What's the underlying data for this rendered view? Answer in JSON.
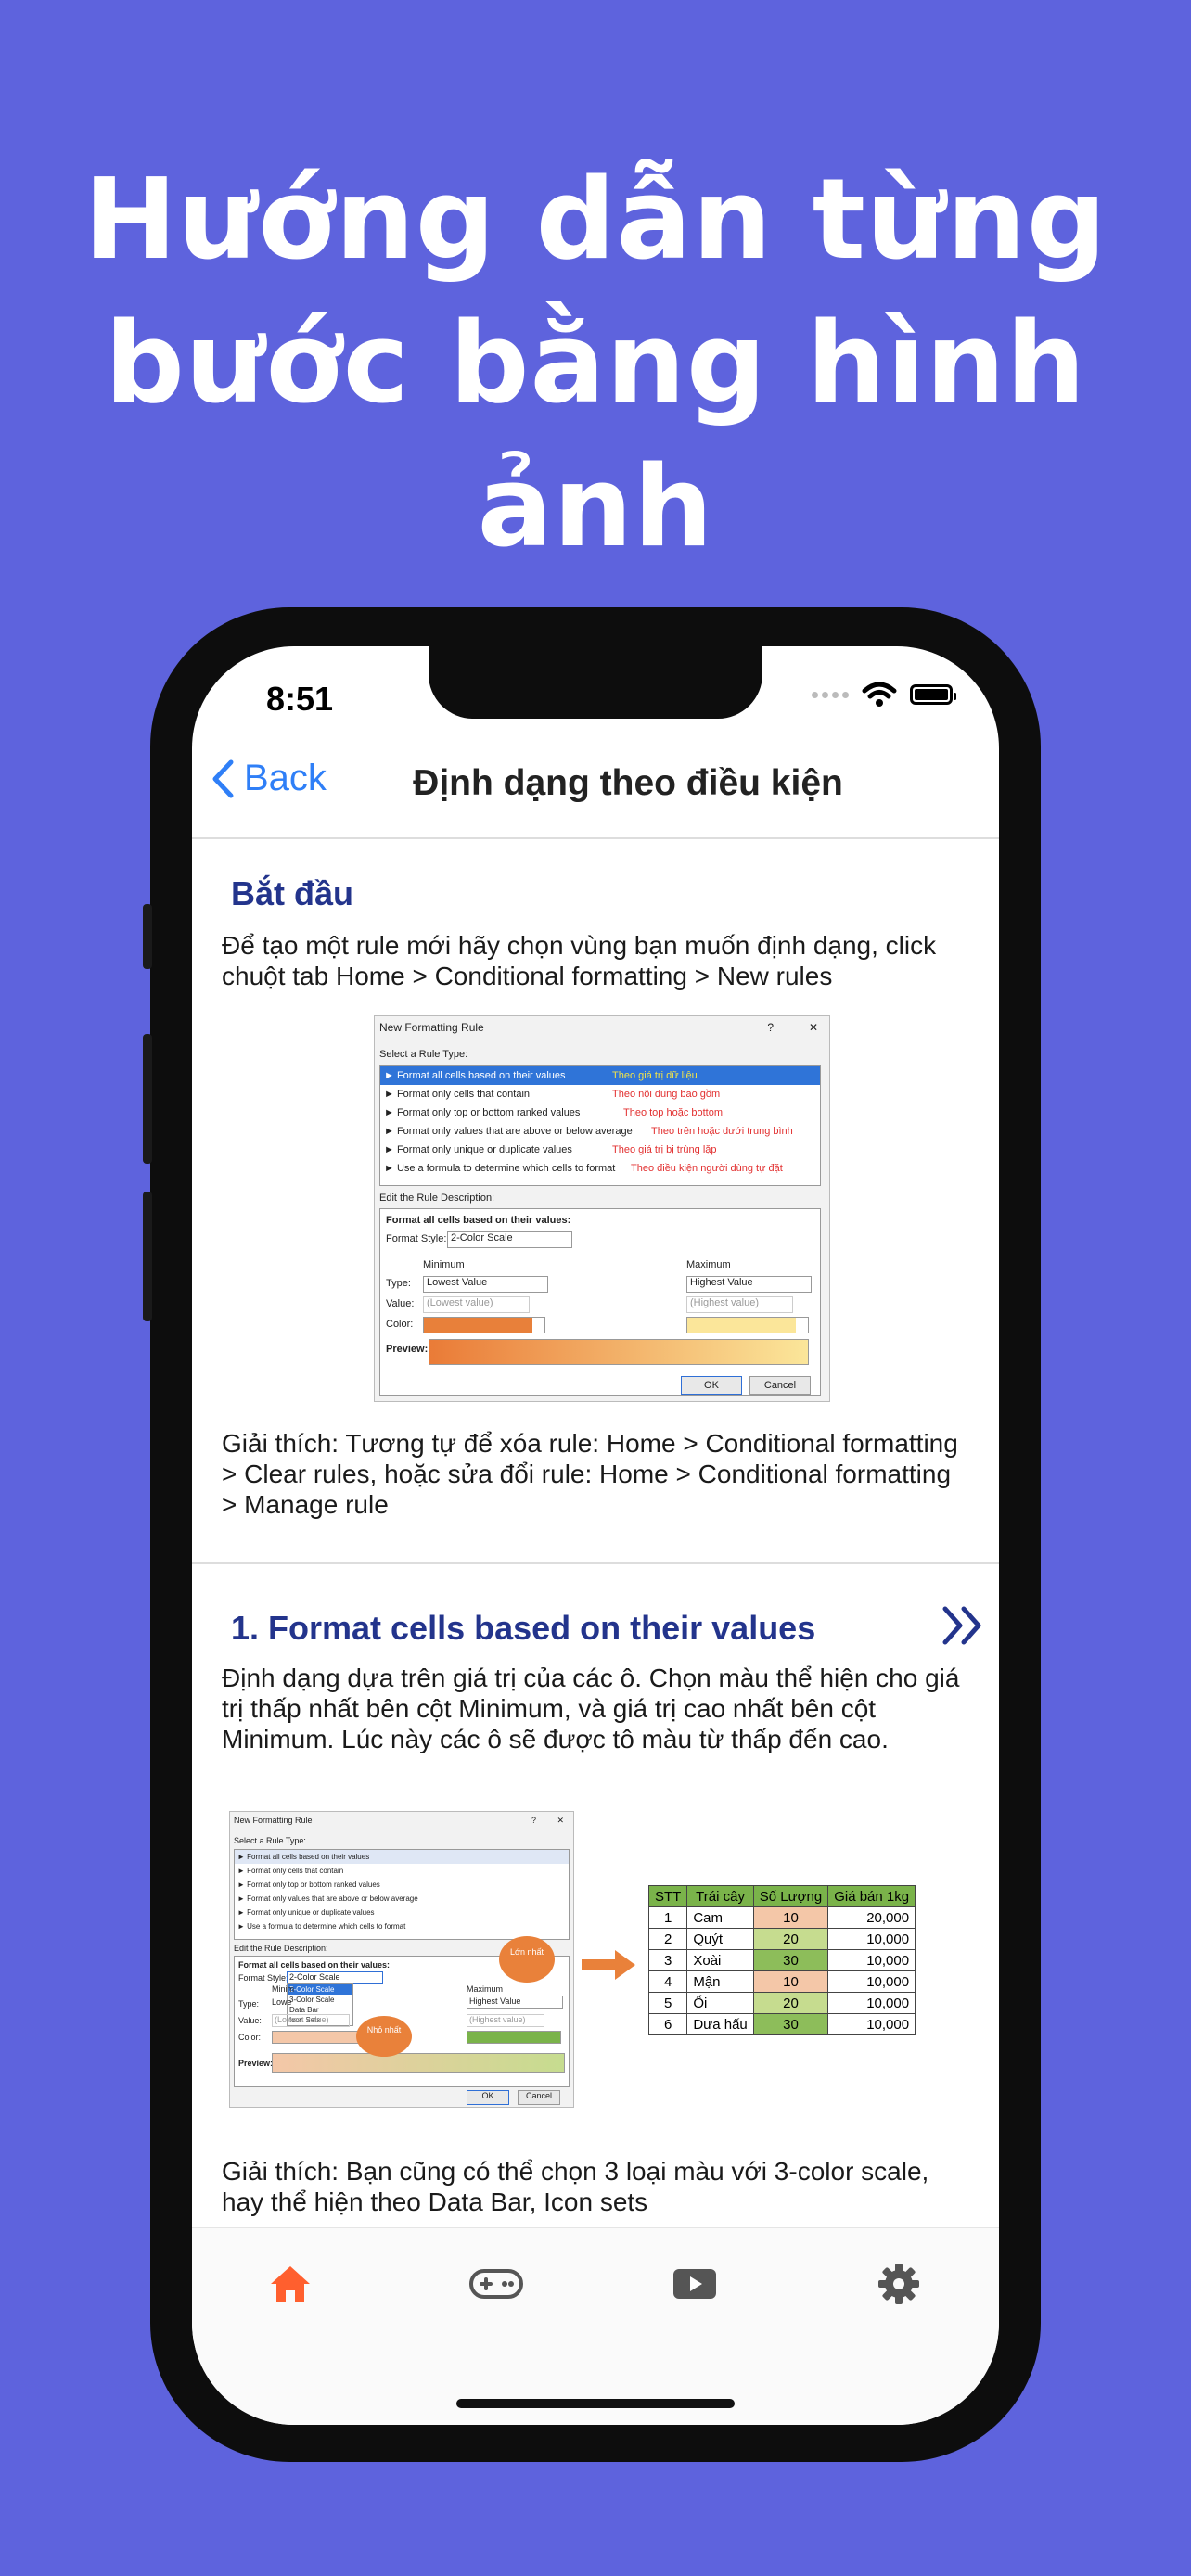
{
  "hero": {
    "line1": "Hướng dẫn từng",
    "line2": "bước bằng hình ảnh"
  },
  "status": {
    "time": "8:51"
  },
  "nav": {
    "back_label": "Back",
    "title": "Định dạng theo điều kiện"
  },
  "section_start": {
    "heading": "Bắt đầu",
    "intro": "Để tạo một rule mới hãy chọn vùng bạn muốn định dạng, click chuột tab Home > Conditional formatting > New rules",
    "explain": "Giải thích: Tương tự để xóa rule: Home > Conditional formatting > Clear rules, hoặc sửa đổi rule: Home > Conditional formatting > Manage rule"
  },
  "dialog1": {
    "title": "New Formatting Rule",
    "help": "?",
    "close": "✕",
    "select_type_label": "Select a Rule Type:",
    "rule_types": [
      {
        "label": "► Format all cells based on their values",
        "note": "Theo giá trị dữ liệu"
      },
      {
        "label": "► Format only cells that contain",
        "note": "Theo nội dung bao gồm"
      },
      {
        "label": "► Format only top or bottom ranked values",
        "note": "Theo top hoặc bottom"
      },
      {
        "label": "► Format only values that are above or below average",
        "note": "Theo trên hoặc dưới trung bình"
      },
      {
        "label": "► Format only unique or duplicate values",
        "note": "Theo giá trị bị trùng lặp"
      },
      {
        "label": "► Use a formula to determine which cells to format",
        "note": "Theo điều kiện người dùng tự đặt"
      }
    ],
    "edit_desc_label": "Edit the Rule Description:",
    "format_all_label": "Format all cells based on their values:",
    "format_style_label": "Format Style:",
    "format_style_value": "2-Color Scale",
    "minimum_label": "Minimum",
    "maximum_label": "Maximum",
    "type_label": "Type:",
    "value_label": "Value:",
    "color_label": "Color:",
    "min_type": "Lowest Value",
    "max_type": "Highest Value",
    "min_value": "(Lowest value)",
    "max_value": "(Highest value)",
    "preview_label": "Preview:",
    "ok": "OK",
    "cancel": "Cancel"
  },
  "section_1": {
    "heading": "1. Format cells based on their values",
    "intro": "Định dạng dựa trên giá trị của các ô. Chọn màu thể hiện cho giá trị thấp nhất bên cột Minimum, và giá trị cao nhất bên cột Minimum. Lúc này các ô sẽ được tô màu từ thấp đến cao.",
    "explain": "Giải thích: Bạn cũng có thể chọn 3 loại màu với 3-color scale, hay thể hiện theo Data Bar, Icon sets"
  },
  "dialog2": {
    "title": "New Formatting Rule",
    "help": "?",
    "close": "✕",
    "select_type_label": "Select a Rule Type:",
    "rule_types": [
      "► Format all cells based on their values",
      "► Format only cells that contain",
      "► Format only top or bottom ranked values",
      "► Format only values that are above or below average",
      "► Format only unique or duplicate values",
      "► Use a formula to determine which cells to format"
    ],
    "edit_desc_label": "Edit the Rule Description:",
    "format_all_label": "Format all cells based on their values:",
    "format_style_label": "Format Style:",
    "format_style_value": "2-Color Scale",
    "style_options": [
      "2-Color Scale",
      "3-Color Scale",
      "Data Bar",
      "Icon Sets"
    ],
    "minimum_label": "Minim",
    "maximum_label": "Maximum",
    "type_label": "Type:",
    "value_label": "Value:",
    "color_label": "Color:",
    "min_type": "Lowe",
    "max_type": "Highest Value",
    "min_value": "(Lowest value)",
    "max_value": "(Highest value)",
    "callout_low": "Nhỏ nhất",
    "callout_high": "Lớn nhất",
    "preview_label": "Preview:",
    "ok": "OK",
    "cancel": "Cancel"
  },
  "fruit_table": {
    "headers": [
      "STT",
      "Trái cây",
      "Số Lượng",
      "Giá bán 1kg"
    ],
    "rows": [
      [
        "1",
        "Cam",
        "10",
        "20,000"
      ],
      [
        "2",
        "Quýt",
        "20",
        "10,000"
      ],
      [
        "3",
        "Xoài",
        "30",
        "10,000"
      ],
      [
        "4",
        "Mận",
        "10",
        "10,000"
      ],
      [
        "5",
        "Ổi",
        "20",
        "10,000"
      ],
      [
        "6",
        "Dưa hấu",
        "30",
        "10,000"
      ]
    ],
    "qty_colors": {
      "10": "#f4c7a8",
      "20": "#c6dc8f",
      "30": "#8dbd5a"
    }
  },
  "tabbar": {
    "items": [
      {
        "icon": "home-icon",
        "active": true
      },
      {
        "icon": "gamepad-icon",
        "active": false
      },
      {
        "icon": "video-play-icon",
        "active": false
      },
      {
        "icon": "gear-icon",
        "active": false
      }
    ],
    "active_color": "#ff5f2e",
    "inactive_color": "#555555"
  },
  "colors": {
    "background": "#5e63dd",
    "accent": "#2f7ff7",
    "heading": "#23348c"
  }
}
